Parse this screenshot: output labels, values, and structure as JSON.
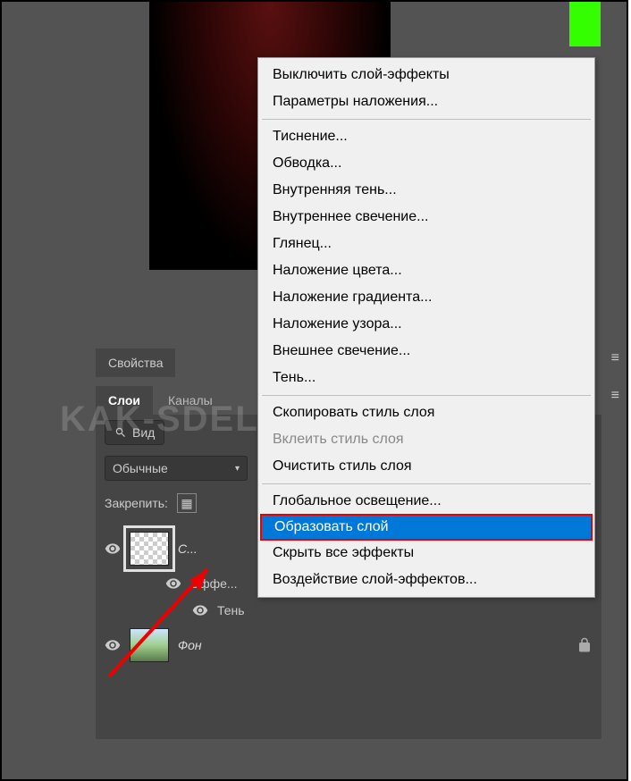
{
  "panel": {
    "properties_tab": "Свойства",
    "layers_tab": "Слои",
    "channels_tab": "Каналы",
    "search_label": "Вид",
    "blend_mode": "Обычные",
    "lock_label": "Закрепить:"
  },
  "layers": [
    {
      "name": "С...",
      "effects_label": "Эффе...",
      "effect_item": "Тень"
    },
    {
      "name": "Фон"
    }
  ],
  "context_menu": {
    "groups": [
      [
        {
          "label": "Выключить слой-эффекты",
          "disabled": false
        },
        {
          "label": "Параметры наложения...",
          "disabled": false
        }
      ],
      [
        {
          "label": "Тиснение...",
          "disabled": false
        },
        {
          "label": "Обводка...",
          "disabled": false
        },
        {
          "label": "Внутренняя тень...",
          "disabled": false
        },
        {
          "label": "Внутреннее свечение...",
          "disabled": false
        },
        {
          "label": "Глянец...",
          "disabled": false
        },
        {
          "label": "Наложение цвета...",
          "disabled": false
        },
        {
          "label": "Наложение градиента...",
          "disabled": false
        },
        {
          "label": "Наложение узора...",
          "disabled": false
        },
        {
          "label": "Внешнее свечение...",
          "disabled": false
        },
        {
          "label": "Тень...",
          "disabled": false
        }
      ],
      [
        {
          "label": "Скопировать стиль слоя",
          "disabled": false
        },
        {
          "label": "Вклеить стиль слоя",
          "disabled": true
        },
        {
          "label": "Очистить стиль слоя",
          "disabled": false
        }
      ],
      [
        {
          "label": "Глобальное освещение...",
          "disabled": false
        },
        {
          "label": "Образовать слой",
          "disabled": false,
          "highlighted": true
        },
        {
          "label": "Скрыть все эффекты",
          "disabled": false
        },
        {
          "label": "Воздействие слой-эффектов...",
          "disabled": false
        }
      ]
    ]
  },
  "watermark": "KAK-SDELAT.ORG"
}
